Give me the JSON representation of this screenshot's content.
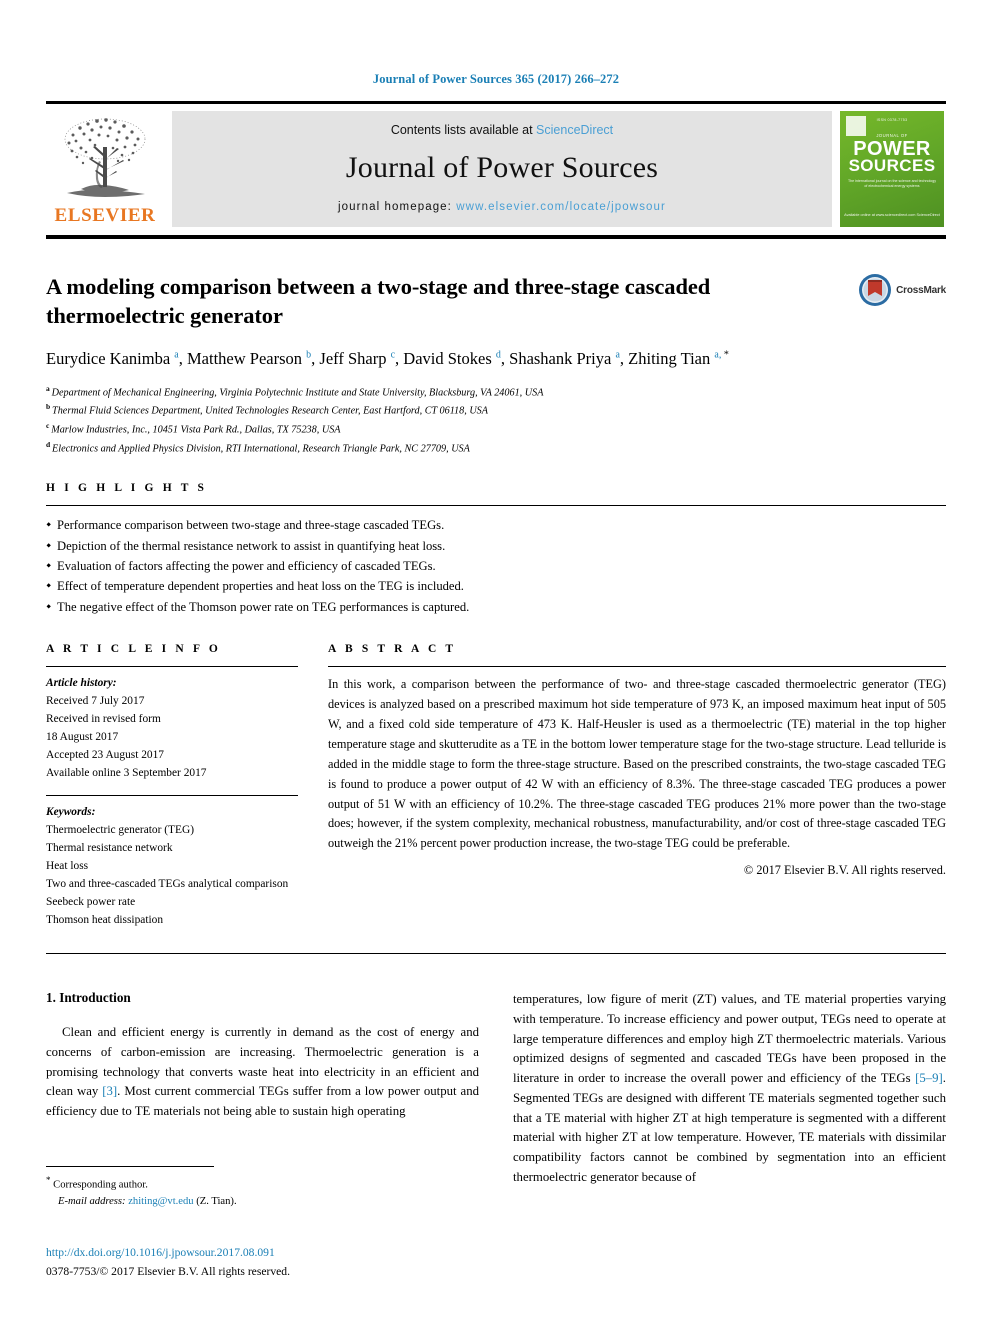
{
  "running_head": "Journal of Power Sources 365 (2017) 266–272",
  "masthead": {
    "contents_prefix": "Contents lists available at ",
    "contents_link": "ScienceDirect",
    "journal_title": "Journal of Power Sources",
    "homepage_prefix": "journal homepage: ",
    "homepage_url": "www.elsevier.com/locate/jpowsour",
    "publisher_wordmark": "ELSEVIER",
    "cover": {
      "top_text": "ISSN 0378-7753",
      "kicker": "JOURNAL OF",
      "line1": "POWER",
      "line2": "SOURCES",
      "subtitle": "The international journal on the science and technology of electrochemical energy systems",
      "footer": "Available online at www.sciencedirect.com\nScienceDirect"
    }
  },
  "article": {
    "title": "A modeling comparison between a two-stage and three-stage cascaded thermoelectric generator",
    "crossmark_label": "CrossMark",
    "authors": [
      {
        "name": "Eurydice Kanimba",
        "marks": "a",
        "sep": ", "
      },
      {
        "name": "Matthew Pearson",
        "marks": "b",
        "sep": ", "
      },
      {
        "name": "Jeff Sharp",
        "marks": "c",
        "sep": ", "
      },
      {
        "name": "David Stokes",
        "marks": "d",
        "sep": ", "
      },
      {
        "name": "Shashank Priya",
        "marks": "a",
        "sep": ", "
      },
      {
        "name": "Zhiting Tian",
        "marks": "a, *",
        "sep": ""
      }
    ],
    "affiliations": [
      {
        "mark": "a",
        "text": "Department of Mechanical Engineering, Virginia Polytechnic Institute and State University, Blacksburg, VA 24061, USA"
      },
      {
        "mark": "b",
        "text": "Thermal Fluid Sciences Department, United Technologies Research Center, East Hartford, CT 06118, USA"
      },
      {
        "mark": "c",
        "text": "Marlow Industries, Inc., 10451 Vista Park Rd., Dallas, TX 75238, USA"
      },
      {
        "mark": "d",
        "text": "Electronics and Applied Physics Division, RTI International, Research Triangle Park, NC 27709, USA"
      }
    ]
  },
  "highlights": {
    "heading": "H I G H L I G H T S",
    "items": [
      "Performance comparison between two-stage and three-stage cascaded TEGs.",
      "Depiction of the thermal resistance network to assist in quantifying heat loss.",
      "Evaluation of factors affecting the power and efficiency of cascaded TEGs.",
      "Effect of temperature dependent properties and heat loss on the TEG is included.",
      "The negative effect of the Thomson power rate on TEG performances is captured."
    ]
  },
  "article_info": {
    "heading": "A R T I C L E  I N F O",
    "history_label": "Article history:",
    "history": [
      "Received 7 July 2017",
      "Received in revised form",
      "18 August 2017",
      "Accepted 23 August 2017",
      "Available online 3 September 2017"
    ],
    "keywords_label": "Keywords:",
    "keywords": [
      "Thermoelectric generator (TEG)",
      "Thermal resistance network",
      "Heat loss",
      "Two and three-cascaded TEGs analytical comparison",
      "Seebeck power rate",
      "Thomson heat dissipation"
    ]
  },
  "abstract": {
    "heading": "A B S T R A C T",
    "text": "In this work, a comparison between the performance of two- and three-stage cascaded thermoelectric generator (TEG) devices is analyzed based on a prescribed maximum hot side temperature of 973 K, an imposed maximum heat input of 505 W, and a fixed cold side temperature of 473 K. Half-Heusler is used as a thermoelectric (TE) material in the top higher temperature stage and skutterudite as a TE in the bottom lower temperature stage for the two-stage structure. Lead telluride is added in the middle stage to form the three-stage structure. Based on the prescribed constraints, the two-stage cascaded TEG is found to produce a power output of 42 W with an efficiency of 8.3%. The three-stage cascaded TEG produces a power output of 51 W with an efficiency of 10.2%. The three-stage cascaded TEG produces 21% more power than the two-stage does; however, if the system complexity, mechanical robustness, manufacturability, and/or cost of three-stage cascaded TEG outweigh the 21% percent power production increase, the two-stage TEG could be preferable.",
    "copyright": "© 2017 Elsevier B.V. All rights reserved."
  },
  "body": {
    "section_number_title": "1. Introduction",
    "left_paragraph_pre": "Clean and efficient energy is currently in demand as the cost of energy and concerns of carbon-emission are increasing. Thermoelectric generation is a promising technology that converts waste heat into electricity in an efficient and clean way ",
    "left_ref": "[3]",
    "left_paragraph_post": ". Most current commercial TEGs suffer from a low power output and efficiency due to TE materials not being able to sustain high operating",
    "right_paragraph_pre": "temperatures, low figure of merit (ZT) values, and TE material properties varying with temperature. To increase efficiency and power output, TEGs need to operate at large temperature differences and employ high ZT thermoelectric materials. Various optimized designs of segmented and cascaded TEGs have been proposed in the literature in order to increase the overall power and efficiency of the TEGs ",
    "right_ref": "[5–9]",
    "right_paragraph_post": ". Segmented TEGs are designed with different TE materials segmented together such that a TE material with higher ZT at high temperature is segmented with a different material with higher ZT at low temperature. However, TE materials with dissimilar compatibility factors cannot be combined by segmentation into an efficient thermoelectric generator because of"
  },
  "footer": {
    "corresponding_star": "*",
    "corresponding_label": "Corresponding author.",
    "email_label": "E-mail address:",
    "email": "zhiting@vt.edu",
    "email_suffix": "(Z. Tian).",
    "doi": "http://dx.doi.org/10.1016/j.jpowsour.2017.08.091",
    "issn_line": "0378-7753/© 2017 Elsevier B.V. All rights reserved."
  },
  "colors": {
    "link_blue": "#1a7fb5",
    "elsevier_orange": "#e87722",
    "cover_green": "#76b82a"
  }
}
